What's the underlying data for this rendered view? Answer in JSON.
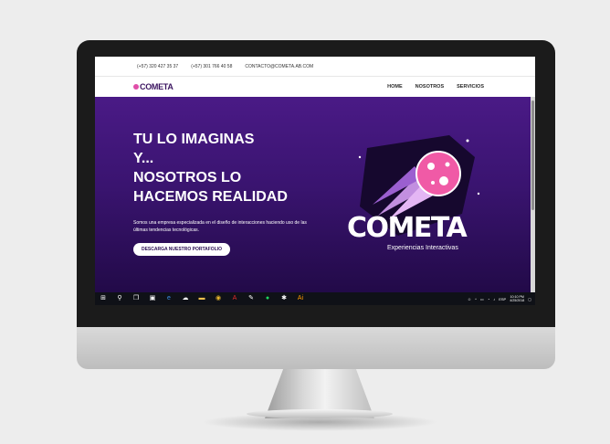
{
  "contact": {
    "phone1": "(+57) 320 427 35 37",
    "phone2": "(+57) 301 766 40 58",
    "email": "CONTACTO@COMETA.AB.COM"
  },
  "nav": {
    "logo_text": "COMETA",
    "links": [
      "HOME",
      "NOSOTROS",
      "SERVICIOS"
    ]
  },
  "hero": {
    "title_lines": [
      "TU LO IMAGINAS",
      "Y...",
      "NOSOTROS LO",
      "HACEMOS REALIDAD"
    ],
    "description": "Somos una empresa especializada en el diseño de interacciones haciendo uso de las últimas tendencias tecnológicas.",
    "button_label": "DESCARGA NUESTRO PORTAFOLIO"
  },
  "brand": {
    "wordmark": "COMETA",
    "subtitle": "Experiencias Interactivas"
  },
  "taskbar": {
    "language": "ESP",
    "time": "10:10 PM",
    "date": "4/25/2018"
  },
  "colors": {
    "hero_top": "#4a1a86",
    "hero_bottom": "#220a48",
    "accent_pink": "#e04ea8",
    "taskbar": "#0f1117"
  }
}
